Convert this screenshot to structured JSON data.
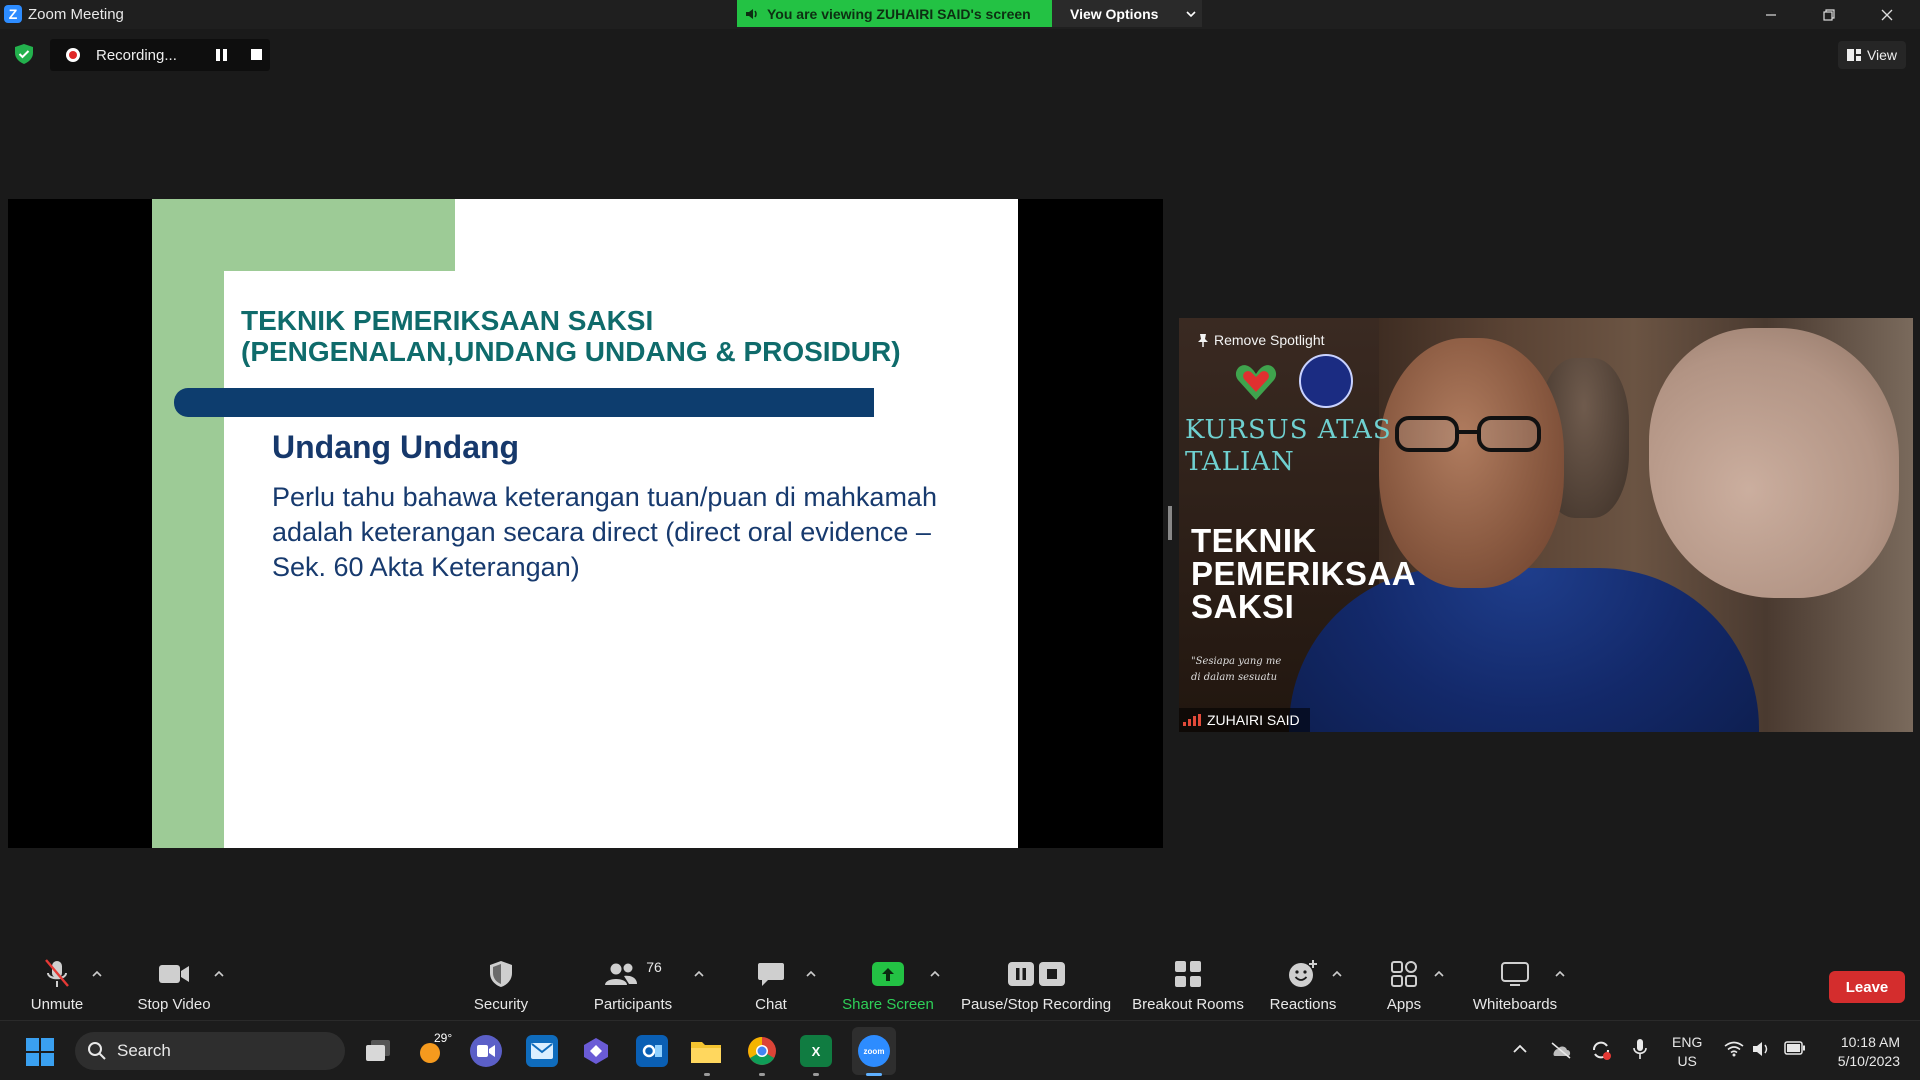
{
  "window": {
    "app_title": "Zoom Meeting",
    "viewing_banner": "You are viewing ZUHAIRI SAID's screen",
    "view_options_label": "View Options"
  },
  "recording": {
    "label": "Recording...",
    "view_label": "View"
  },
  "slide": {
    "title": "TEKNIK PEMERIKSAAN SAKSI\n(PENGENALAN,UNDANG UNDANG & PROSIDUR)",
    "heading": "Undang Undang",
    "body": "Perlu tahu bahawa keterangan tuan/puan di mahkamah  adalah keterangan secara direct (direct oral evidence – Sek. 60 Akta Keterangan)",
    "colors": {
      "green": "#9dcb96",
      "blue_bar": "#0d3d6e",
      "title": "#0f6b6b",
      "text": "#173a6e"
    }
  },
  "spotlight": {
    "remove_label": "Remove Spotlight",
    "poster_kursus": "KURSUS ATAS\nTALIAN",
    "poster_title": "TEKNIK\nPEMERIKSAA\nSAKSI",
    "poster_quote": "\"Sesiapa yang me\ndi dalam sesuatu",
    "participant_name": "ZUHAIRI SAID"
  },
  "toolbar": {
    "unmute": "Unmute",
    "stop_video": "Stop Video",
    "security": "Security",
    "participants": "Participants",
    "participant_count": "76",
    "chat": "Chat",
    "share_screen": "Share Screen",
    "pause_stop_recording": "Pause/Stop Recording",
    "breakout_rooms": "Breakout Rooms",
    "reactions": "Reactions",
    "apps": "Apps",
    "whiteboards": "Whiteboards",
    "leave": "Leave"
  },
  "taskbar": {
    "search_label": "Search",
    "weather_temp": "29°",
    "lang_top": "ENG",
    "lang_bottom": "US",
    "time": "10:18 AM",
    "date": "5/10/2023",
    "excel_label": "X",
    "zoom_label": "zoom"
  }
}
